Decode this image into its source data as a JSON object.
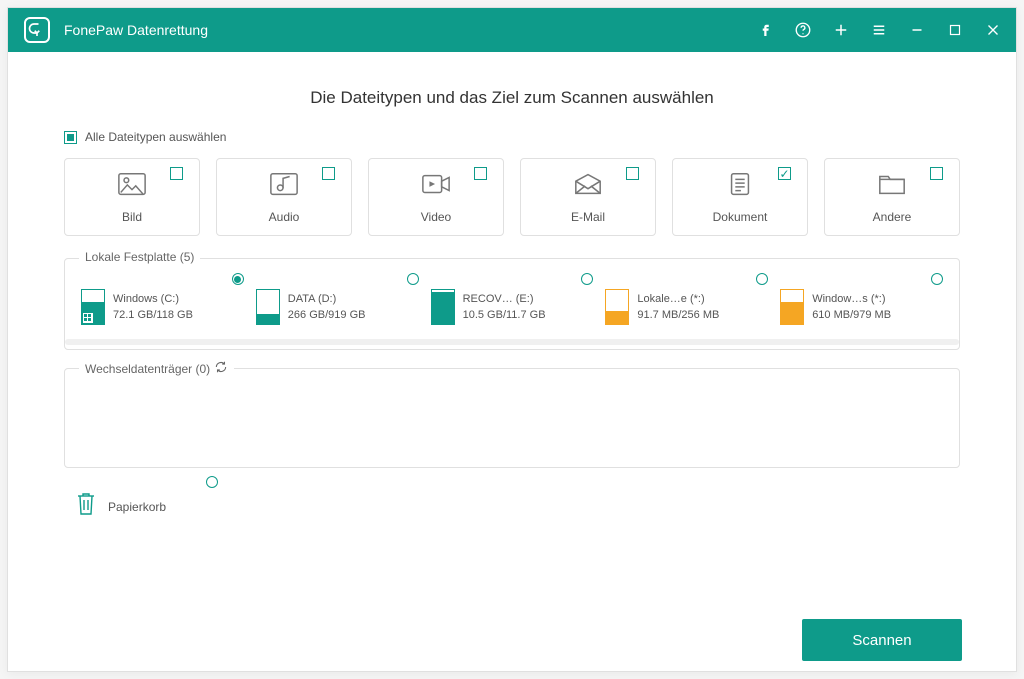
{
  "app": {
    "title": "FonePaw Datenrettung"
  },
  "page": {
    "heading": "Die Dateitypen und das Ziel zum Scannen auswählen",
    "select_all": "Alle Dateitypen auswählen"
  },
  "file_types": [
    {
      "id": "image",
      "label": "Bild",
      "checked": false
    },
    {
      "id": "audio",
      "label": "Audio",
      "checked": false
    },
    {
      "id": "video",
      "label": "Video",
      "checked": false
    },
    {
      "id": "email",
      "label": "E-Mail",
      "checked": false
    },
    {
      "id": "document",
      "label": "Dokument",
      "checked": true
    },
    {
      "id": "other",
      "label": "Andere",
      "checked": false
    }
  ],
  "local_drives": {
    "group_title": "Lokale Festplatte (5)",
    "items": [
      {
        "name": "Windows (C:)",
        "size": "72.1 GB/118 GB",
        "fill": 0.61,
        "color": "#0e9b8a",
        "selected": true,
        "has_os_icon": true
      },
      {
        "name": "DATA (D:)",
        "size": "266 GB/919 GB",
        "fill": 0.29,
        "color": "#0e9b8a",
        "selected": false,
        "has_os_icon": false
      },
      {
        "name": "RECOV… (E:)",
        "size": "10.5 GB/11.7 GB",
        "fill": 0.9,
        "color": "#0e9b8a",
        "selected": false,
        "has_os_icon": false
      },
      {
        "name": "Lokale…e (*:)",
        "size": "91.7 MB/256 MB",
        "fill": 0.36,
        "color": "#f5a623",
        "selected": false,
        "has_os_icon": false
      },
      {
        "name": "Window…s (*:)",
        "size": "610 MB/979 MB",
        "fill": 0.62,
        "color": "#f5a623",
        "selected": false,
        "has_os_icon": false
      }
    ]
  },
  "removable": {
    "group_title": "Wechseldatenträger (0)"
  },
  "recycle": {
    "label": "Papierkorb"
  },
  "scan_button": "Scannen"
}
